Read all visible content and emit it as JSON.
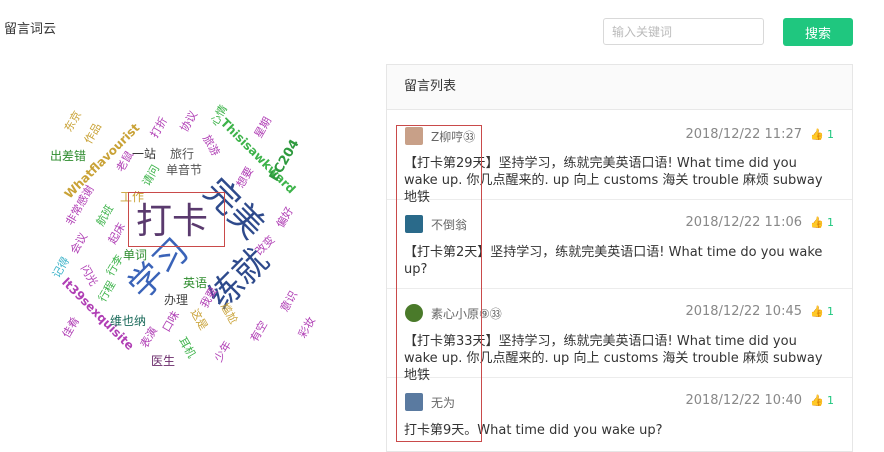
{
  "header": {
    "title": "留言词云",
    "search_placeholder": "输入关键词",
    "search_button": "搜索"
  },
  "wordcloud": {
    "words": [
      {
        "text": "打卡",
        "color": "#5a3a6e"
      },
      {
        "text": "学习",
        "color": "#3a63b8"
      },
      {
        "text": "练就",
        "color": "#2e4a8c"
      },
      {
        "text": "完美",
        "color": "#2e4a8c"
      },
      {
        "text": "Thisisawkward",
        "color": "#3db34a"
      },
      {
        "text": "Whatflavourist",
        "color": "#c9a236"
      },
      {
        "text": "lt39sexquisite",
        "color": "#b03fb5"
      },
      {
        "text": "EC204",
        "color": "#2e9a3e"
      },
      {
        "text": "出差错",
        "color": "#2e8c2e"
      },
      {
        "text": "一站",
        "color": "#333333"
      },
      {
        "text": "旅行",
        "color": "#555555"
      },
      {
        "text": "单音节",
        "color": "#555555"
      },
      {
        "text": "工作",
        "color": "#c9a236"
      },
      {
        "text": "单词",
        "color": "#2e8c2e"
      },
      {
        "text": "英语",
        "color": "#2e8c2e"
      },
      {
        "text": "办理",
        "color": "#444444"
      },
      {
        "text": "维也纳",
        "color": "#1a6a5a"
      },
      {
        "text": "医生",
        "color": "#6a2a6a"
      },
      {
        "text": "作品",
        "color": "#c9a236"
      },
      {
        "text": "东京",
        "color": "#c9a236"
      },
      {
        "text": "航班",
        "color": "#3db34a"
      },
      {
        "text": "打折",
        "color": "#b03fb5"
      },
      {
        "text": "协议",
        "color": "#b03fb5"
      },
      {
        "text": "心情",
        "color": "#3db34a"
      },
      {
        "text": "星期",
        "color": "#b03fb5"
      },
      {
        "text": "旅游",
        "color": "#b03fb5"
      },
      {
        "text": "老鼠",
        "color": "#b03fb5"
      },
      {
        "text": "非常感谢",
        "color": "#b03fb5"
      },
      {
        "text": "起床",
        "color": "#b03fb5"
      },
      {
        "text": "记得",
        "color": "#3db3c9"
      },
      {
        "text": "闪光",
        "color": "#b03fb5"
      },
      {
        "text": "行程",
        "color": "#3db34a"
      },
      {
        "text": "行李",
        "color": "#3db34a"
      },
      {
        "text": "会议",
        "color": "#b03fb5"
      },
      {
        "text": "我要",
        "color": "#b03fb5"
      },
      {
        "text": "尴尬",
        "color": "#c9a236"
      },
      {
        "text": "改变",
        "color": "#b03fb5"
      },
      {
        "text": "意识",
        "color": "#b03fb5"
      },
      {
        "text": "有空",
        "color": "#b03fb5"
      },
      {
        "text": "彩妆",
        "color": "#b03fb5"
      },
      {
        "text": "表演",
        "color": "#b03fb5"
      },
      {
        "text": "口味",
        "color": "#b03fb5"
      },
      {
        "text": "这是",
        "color": "#c9a236"
      },
      {
        "text": "佳肴",
        "color": "#b03fb5"
      },
      {
        "text": "耳机",
        "color": "#3db34a"
      },
      {
        "text": "少年",
        "color": "#b03fb5"
      },
      {
        "text": "想要",
        "color": "#b03fb5"
      },
      {
        "text": "请问",
        "color": "#3db34a"
      },
      {
        "text": "偏好",
        "color": "#b03fb5"
      }
    ]
  },
  "panel": {
    "title": "留言列表",
    "messages": [
      {
        "user": "Z柳哼㉝",
        "time": "2018/12/22 11:27",
        "likes": "1",
        "text": "【打卡第29天】坚持学习，练就完美英语口语!    What time did you wake up. 你几点醒来的. up 向上 customs 海关 trouble 麻烦 subway 地铁",
        "avatar_color": "#c8a088"
      },
      {
        "user": "不倒翁",
        "time": "2018/12/22 11:06",
        "likes": "1",
        "text": "【打卡第2天】坚持学习，练就完美英语口语!    What time do you wake up?",
        "avatar_color": "#2a6a8a"
      },
      {
        "user": "素心小原⑨㉝",
        "time": "2018/12/22 10:45",
        "likes": "1",
        "text": "【打卡第33天】坚持学习，练就完美英语口语!    What time did you wake up. 你几点醒来的. up 向上 customs 海关 trouble 麻烦 subway 地铁",
        "avatar_color": "#4a7a2a"
      },
      {
        "user": "无为",
        "time": "2018/12/22 10:40",
        "likes": "1",
        "text": "打卡第9天。What time did you wake up?",
        "avatar_color": "#5a7aa0"
      }
    ]
  }
}
